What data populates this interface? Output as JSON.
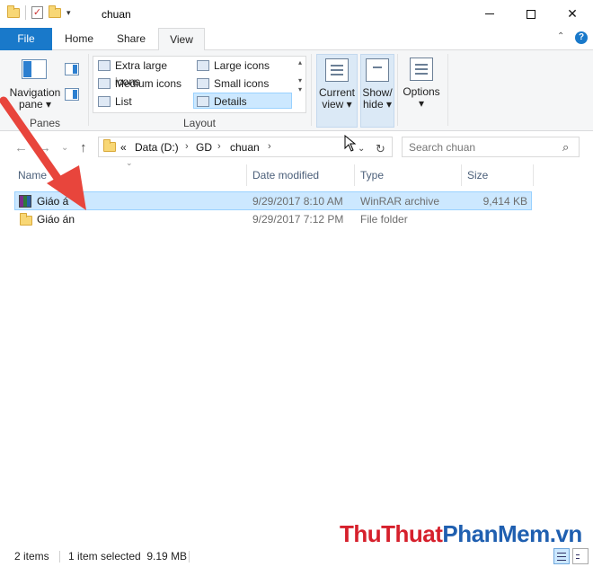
{
  "window": {
    "title": "chuan",
    "minimize_icon": "minimize-icon",
    "maximize_icon": "maximize-icon",
    "close_icon": "close-icon",
    "close_glyph": "✕"
  },
  "tabs": [
    {
      "label": "File"
    },
    {
      "label": "Home"
    },
    {
      "label": "Share"
    },
    {
      "label": "View"
    }
  ],
  "ribbon": {
    "help": "?",
    "panes": {
      "navigation_pane_label": "Navigation",
      "navigation_pane_label2": "pane ▾",
      "group_label": "Panes"
    },
    "layout": {
      "items": [
        {
          "label": "Extra large icons"
        },
        {
          "label": "Large icons"
        },
        {
          "label": "Medium icons"
        },
        {
          "label": "Small icons"
        },
        {
          "label": "List"
        },
        {
          "label": "Details"
        }
      ],
      "selected": "Details",
      "group_label": "Layout"
    },
    "current_view": {
      "line1": "Current",
      "line2": "view ▾"
    },
    "show_hide": {
      "line1": "Show/",
      "line2": "hide ▾"
    },
    "options": {
      "line1": "Options",
      "line2": "▾"
    }
  },
  "address": {
    "prefix": "«",
    "crumbs": [
      "Data (D:)",
      "GD",
      "chuan"
    ],
    "separator": "›",
    "search_placeholder": "Search chuan"
  },
  "columns": [
    "Name",
    "Date modified",
    "Type",
    "Size"
  ],
  "files": [
    {
      "name": "Giáo á",
      "date": "9/29/2017 8:10 AM",
      "type": "WinRAR archive",
      "size": "9,414 KB",
      "selected": true,
      "icon": "winrar-icon"
    },
    {
      "name": "Giáo án",
      "date": "9/29/2017 7:12 PM",
      "type": "File folder",
      "size": "",
      "selected": false,
      "icon": "folder-icon"
    }
  ],
  "status": {
    "items_count": "2 items",
    "selection": "1 item selected  9.19 MB"
  },
  "watermark": {
    "part1": "Thu",
    "part2": "Thuat",
    "part3": "Phan",
    "part4": "Mem",
    "part5": ".vn"
  },
  "colors": {
    "accent": "#1979ca",
    "selection": "#cce8ff",
    "annotation_arrow": "#e8453c"
  }
}
